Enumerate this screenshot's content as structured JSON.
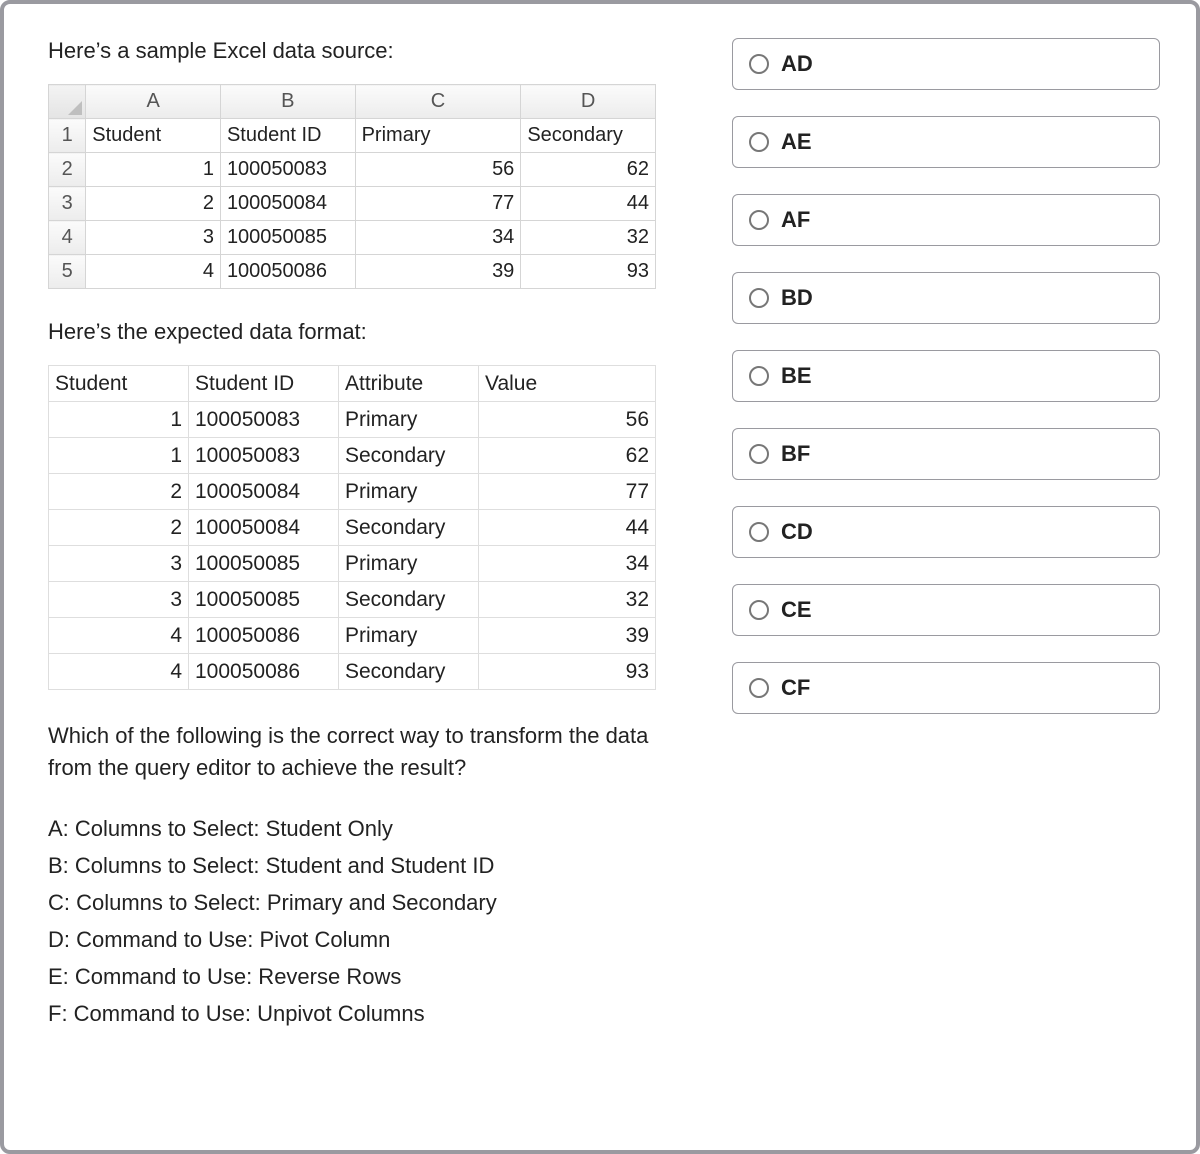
{
  "intro1": "Here’s a sample Excel data source:",
  "intro2": "Here’s the expected data format:",
  "question": "Which of the following is the correct way to transform the data from the query editor to achieve the result?",
  "excel": {
    "col_labels": [
      "A",
      "B",
      "C",
      "D"
    ],
    "row_labels": [
      "1",
      "2",
      "3",
      "4",
      "5"
    ],
    "headers": [
      "Student",
      "Student ID",
      "Primary",
      "Secondary"
    ],
    "rows": [
      {
        "student": "1",
        "id": "100050083",
        "primary": "56",
        "secondary": "62"
      },
      {
        "student": "2",
        "id": "100050084",
        "primary": "77",
        "secondary": "44"
      },
      {
        "student": "3",
        "id": "100050085",
        "primary": "34",
        "secondary": "32"
      },
      {
        "student": "4",
        "id": "100050086",
        "primary": "39",
        "secondary": "93"
      }
    ]
  },
  "expected": {
    "headers": [
      "Student",
      "Student ID",
      "Attribute",
      "Value"
    ],
    "rows": [
      {
        "student": "1",
        "id": "100050083",
        "attr": "Primary",
        "val": "56"
      },
      {
        "student": "1",
        "id": "100050083",
        "attr": "Secondary",
        "val": "62"
      },
      {
        "student": "2",
        "id": "100050084",
        "attr": "Primary",
        "val": "77"
      },
      {
        "student": "2",
        "id": "100050084",
        "attr": "Secondary",
        "val": "44"
      },
      {
        "student": "3",
        "id": "100050085",
        "attr": "Primary",
        "val": "34"
      },
      {
        "student": "3",
        "id": "100050085",
        "attr": "Secondary",
        "val": "32"
      },
      {
        "student": "4",
        "id": "100050086",
        "attr": "Primary",
        "val": "39"
      },
      {
        "student": "4",
        "id": "100050086",
        "attr": "Secondary",
        "val": "93"
      }
    ]
  },
  "defs": {
    "A": "A: Columns to Select: Student Only",
    "B": "B: Columns to Select: Student and Student ID",
    "C": "C: Columns to Select: Primary and Secondary",
    "D": "D: Command to Use: Pivot Column",
    "E": "E: Command to Use: Reverse Rows",
    "F": "F: Command to Use: Unpivot Columns"
  },
  "choices": [
    "AD",
    "AE",
    "AF",
    "BD",
    "BE",
    "BF",
    "CD",
    "CE",
    "CF"
  ]
}
